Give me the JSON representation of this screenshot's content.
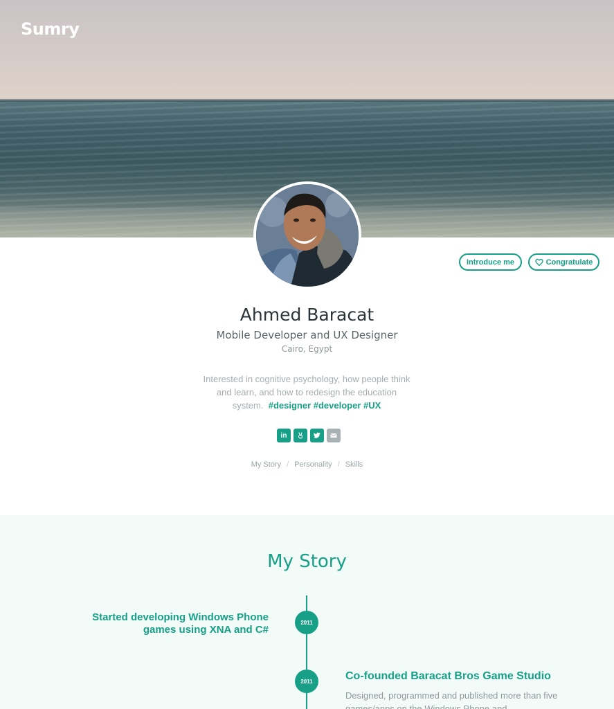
{
  "brand": {
    "logo_text": "Sumry"
  },
  "actions": {
    "introduce_label": "Introduce me",
    "congratulate_label": "Congratulate"
  },
  "profile": {
    "name": "Ahmed Baracat",
    "title": "Mobile Developer and UX Designer",
    "location": "Cairo, Egypt",
    "bio": "Interested in cognitive psychology, how people think and learn, and how to redesign the education system.",
    "tags": "#designer #developer #UX"
  },
  "socials": [
    {
      "name": "linkedin-icon",
      "label": "in"
    },
    {
      "name": "angellist-icon",
      "label": ""
    },
    {
      "name": "twitter-icon",
      "label": ""
    },
    {
      "name": "email-icon",
      "label": ""
    }
  ],
  "nav": {
    "items": [
      "My Story",
      "Personality",
      "Skills"
    ],
    "separator": "/"
  },
  "story": {
    "heading": "My Story",
    "events": [
      {
        "year": "2011",
        "title": "Started developing Windows Phone games using XNA and C#"
      },
      {
        "year": "2011",
        "title": "Co-founded Baracat Bros Game Studio",
        "description": "Designed, programmed and published more than five games/apps on the Windows Phone and"
      }
    ]
  },
  "colors": {
    "accent": "#17a087",
    "story_background": "#f3fbf9",
    "muted_text": "#a5adb0"
  }
}
